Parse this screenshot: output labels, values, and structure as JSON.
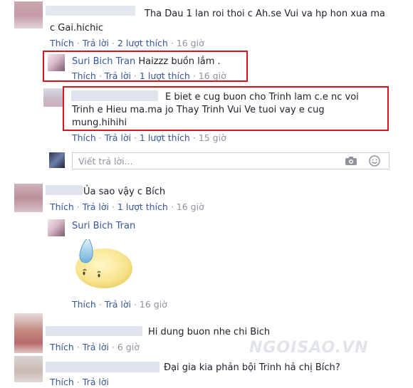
{
  "comments": [
    {
      "text_line1": "Tha Dau 1 lan roi thoi c Ah.se Vui va hp hon xua ma",
      "text_line2": "c Gai.hichic",
      "actions": {
        "like": "Thích",
        "reply": "Trả lời",
        "likes": "2 lượt thích",
        "time": "16 giờ"
      },
      "replies": [
        {
          "author": "Suri Bich Tran",
          "text": "Haizzz buồn lắm .",
          "actions": {
            "like": "Thích",
            "reply": "Trả lời",
            "likes": "1 lượt thích",
            "time": "16 giờ"
          }
        },
        {
          "text_line1": "E biet e cug buon cho Trinh lam c.e nc voi",
          "text_line2": "Trinh e Hieu ma.ma jo Thay Trinh Vui Ve tuoi vay e cug",
          "text_line3": "mung.hihihi",
          "actions": {
            "like": "Thích",
            "reply": "Trả lời",
            "likes": "1 lượt thích",
            "time": "15 giờ"
          }
        }
      ],
      "reply_box": {
        "placeholder": "Viết trả lời...",
        "camera_icon": "camera-icon",
        "emoji_icon": "smiley-icon"
      }
    },
    {
      "text": "Ủa sao vậy c Bích",
      "actions": {
        "like": "Thích",
        "reply": "Trả lời",
        "likes": "1 lượt thích",
        "time": "16 giờ"
      },
      "replies": [
        {
          "author": "Suri Bich Tran",
          "sticker": "sweat-sad-face-sticker",
          "actions": {
            "like": "Thích",
            "reply": "Trả lời",
            "time": "16 giờ"
          }
        }
      ]
    },
    {
      "text": "Hi dung buon nhe chi Bich",
      "actions": {
        "like": "Thích",
        "reply": "Trả lời",
        "time": "6 giờ"
      }
    },
    {
      "text": "Đại gia kia phản bội Trinh hả chị Bích?",
      "actions": {
        "like": "Thích",
        "reply": "Trả lời"
      }
    }
  ],
  "separator": "·",
  "watermark": "NGOISAO.VN",
  "colors": {
    "link": "#365899",
    "meta": "#90949c",
    "highlight": "#d8141f"
  }
}
